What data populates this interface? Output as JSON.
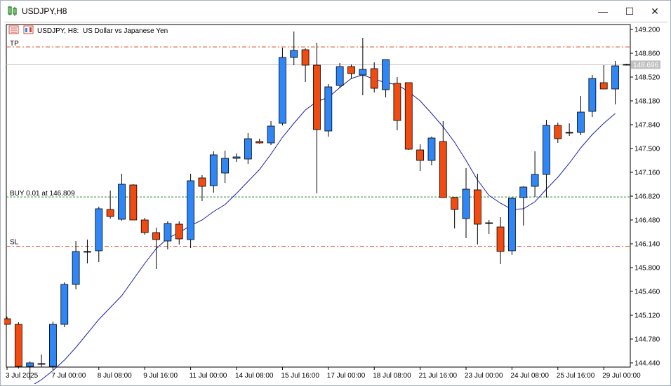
{
  "window": {
    "title": "USDJPY,H8",
    "controls": {
      "minimize": "—",
      "maximize": "☐",
      "close": "✕"
    }
  },
  "chart_header": {
    "symbol": "USDJPY, H8:",
    "description": "US Dollar vs Japanese Yen"
  },
  "levels": {
    "tp_label": "TP",
    "buy_label": "BUY 0.01 at 146.809",
    "sl_label": "SL",
    "current_price": "148.696"
  },
  "colors": {
    "bull": "#2f86f6",
    "bear": "#f24b12",
    "ma": "#1c1fa8",
    "tp_sl": "#e0522a",
    "buy": "#2e8b2e",
    "bid_line": "#c0c0c0",
    "frame": "#000000"
  },
  "chart_data": {
    "type": "candlestick",
    "ylim": [
      144.1,
      149.32
    ],
    "y_ticks": [
      "149.200",
      "148.860",
      "148.520",
      "148.180",
      "147.840",
      "147.500",
      "147.160",
      "146.820",
      "146.480",
      "146.140",
      "145.800",
      "145.460",
      "145.120",
      "144.780",
      "144.440"
    ],
    "y_tick_values": [
      149.2,
      148.86,
      148.52,
      148.18,
      147.84,
      147.5,
      147.16,
      146.82,
      146.48,
      146.14,
      145.8,
      145.46,
      145.12,
      144.78,
      144.44
    ],
    "x_labels": [
      {
        "label": "3 Jul 2025",
        "index": 0
      },
      {
        "label": "7 Jul 00:00",
        "index": 4
      },
      {
        "label": "8 Jul 08:00",
        "index": 8
      },
      {
        "label": "9 Jul 16:00",
        "index": 12
      },
      {
        "label": "11 Jul 00:00",
        "index": 16
      },
      {
        "label": "14 Jul 08:00",
        "index": 20
      },
      {
        "label": "15 Jul 16:00",
        "index": 24
      },
      {
        "label": "17 Jul 00:00",
        "index": 28
      },
      {
        "label": "18 Jul 08:00",
        "index": 32
      },
      {
        "label": "21 Jul 16:00",
        "index": 36
      },
      {
        "label": "23 Jul 00:00",
        "index": 40
      },
      {
        "label": "24 Jul 08:00",
        "index": 44
      },
      {
        "label": "25 Jul 16:00",
        "index": 48
      },
      {
        "label": "29 Jul 00:00",
        "index": 52
      }
    ],
    "candles": [
      {
        "o": 145.07,
        "h": 145.1,
        "l": 145.0,
        "c": 144.99
      },
      {
        "o": 144.99,
        "h": 145.02,
        "l": 144.36,
        "c": 144.39
      },
      {
        "o": 144.39,
        "h": 144.46,
        "l": 144.2,
        "c": 144.44
      },
      {
        "o": 144.43,
        "h": 144.56,
        "l": 144.38,
        "c": 144.43
      },
      {
        "o": 144.39,
        "h": 145.03,
        "l": 144.37,
        "c": 144.99
      },
      {
        "o": 144.99,
        "h": 145.59,
        "l": 144.95,
        "c": 145.56
      },
      {
        "o": 145.56,
        "h": 146.18,
        "l": 145.49,
        "c": 146.03
      },
      {
        "o": 146.03,
        "h": 146.2,
        "l": 145.86,
        "c": 146.03
      },
      {
        "o": 146.04,
        "h": 146.67,
        "l": 145.88,
        "c": 146.64
      },
      {
        "o": 146.63,
        "h": 146.9,
        "l": 146.5,
        "c": 146.53
      },
      {
        "o": 146.49,
        "h": 147.14,
        "l": 146.47,
        "c": 146.99
      },
      {
        "o": 146.98,
        "h": 146.99,
        "l": 146.48,
        "c": 146.48
      },
      {
        "o": 146.48,
        "h": 146.51,
        "l": 146.27,
        "c": 146.3
      },
      {
        "o": 146.3,
        "h": 146.37,
        "l": 145.78,
        "c": 146.2
      },
      {
        "o": 146.18,
        "h": 146.46,
        "l": 146.06,
        "c": 146.43
      },
      {
        "o": 146.42,
        "h": 146.46,
        "l": 146.13,
        "c": 146.21
      },
      {
        "o": 146.2,
        "h": 147.14,
        "l": 146.08,
        "c": 147.04
      },
      {
        "o": 147.08,
        "h": 147.12,
        "l": 146.75,
        "c": 146.96
      },
      {
        "o": 146.97,
        "h": 147.46,
        "l": 146.87,
        "c": 147.41
      },
      {
        "o": 147.15,
        "h": 147.47,
        "l": 147.01,
        "c": 147.36
      },
      {
        "o": 147.36,
        "h": 147.43,
        "l": 147.31,
        "c": 147.38
      },
      {
        "o": 147.35,
        "h": 147.72,
        "l": 147.28,
        "c": 147.64
      },
      {
        "o": 147.6,
        "h": 147.64,
        "l": 147.57,
        "c": 147.58
      },
      {
        "o": 147.58,
        "h": 147.89,
        "l": 147.55,
        "c": 147.82
      },
      {
        "o": 147.86,
        "h": 148.94,
        "l": 147.83,
        "c": 148.8
      },
      {
        "o": 148.8,
        "h": 149.17,
        "l": 148.69,
        "c": 148.9
      },
      {
        "o": 148.91,
        "h": 148.93,
        "l": 148.45,
        "c": 148.69
      },
      {
        "o": 148.69,
        "h": 149.01,
        "l": 146.86,
        "c": 147.77
      },
      {
        "o": 147.75,
        "h": 148.42,
        "l": 147.67,
        "c": 148.38
      },
      {
        "o": 148.4,
        "h": 148.72,
        "l": 148.36,
        "c": 148.67
      },
      {
        "o": 148.67,
        "h": 148.7,
        "l": 148.5,
        "c": 148.57
      },
      {
        "o": 148.55,
        "h": 149.08,
        "l": 148.26,
        "c": 148.63
      },
      {
        "o": 148.64,
        "h": 148.73,
        "l": 148.3,
        "c": 148.36
      },
      {
        "o": 148.34,
        "h": 148.7,
        "l": 148.23,
        "c": 148.77
      },
      {
        "o": 148.43,
        "h": 148.52,
        "l": 147.76,
        "c": 147.9
      },
      {
        "o": 148.44,
        "h": 148.44,
        "l": 147.48,
        "c": 147.49
      },
      {
        "o": 147.48,
        "h": 147.56,
        "l": 147.18,
        "c": 147.33
      },
      {
        "o": 147.33,
        "h": 147.67,
        "l": 147.26,
        "c": 147.65
      },
      {
        "o": 147.6,
        "h": 147.89,
        "l": 146.8,
        "c": 146.8
      },
      {
        "o": 146.8,
        "h": 146.81,
        "l": 146.36,
        "c": 146.63
      },
      {
        "o": 146.5,
        "h": 147.22,
        "l": 146.22,
        "c": 146.92
      },
      {
        "o": 146.91,
        "h": 147.14,
        "l": 146.13,
        "c": 146.42
      },
      {
        "o": 146.43,
        "h": 146.48,
        "l": 146.28,
        "c": 146.44
      },
      {
        "o": 146.38,
        "h": 146.52,
        "l": 145.85,
        "c": 146.03
      },
      {
        "o": 146.04,
        "h": 146.81,
        "l": 145.98,
        "c": 146.79
      },
      {
        "o": 146.8,
        "h": 146.96,
        "l": 146.4,
        "c": 146.95
      },
      {
        "o": 146.96,
        "h": 147.46,
        "l": 146.81,
        "c": 147.13
      },
      {
        "o": 147.13,
        "h": 147.91,
        "l": 146.8,
        "c": 147.83
      },
      {
        "o": 147.83,
        "h": 147.87,
        "l": 147.58,
        "c": 147.64
      },
      {
        "o": 147.73,
        "h": 147.86,
        "l": 147.68,
        "c": 147.73
      },
      {
        "o": 147.73,
        "h": 148.25,
        "l": 147.69,
        "c": 148.02
      },
      {
        "o": 148.03,
        "h": 148.55,
        "l": 147.95,
        "c": 148.5
      },
      {
        "o": 148.44,
        "h": 148.69,
        "l": 148.37,
        "c": 148.35
      },
      {
        "o": 148.35,
        "h": 148.75,
        "l": 148.13,
        "c": 148.68
      },
      {
        "o": 148.69,
        "h": 148.71,
        "l": 148.69,
        "c": 148.7
      }
    ],
    "ma": [
      144.05,
      144.1,
      144.2,
      144.33,
      144.48,
      144.66,
      144.86,
      145.06,
      145.23,
      145.4,
      145.63,
      145.86,
      146.07,
      146.22,
      146.3,
      146.4,
      146.48,
      146.6,
      146.7,
      146.86,
      147.03,
      147.2,
      147.42,
      147.66,
      147.86,
      148.05,
      148.17,
      148.23,
      148.37,
      148.5,
      148.55,
      148.49,
      148.44,
      148.41,
      148.31,
      148.18,
      148.0,
      147.81,
      147.59,
      147.33,
      147.05,
      146.83,
      146.72,
      146.63,
      146.64,
      146.74,
      146.92,
      147.09,
      147.29,
      147.51,
      147.7,
      147.86,
      148.0
    ]
  }
}
